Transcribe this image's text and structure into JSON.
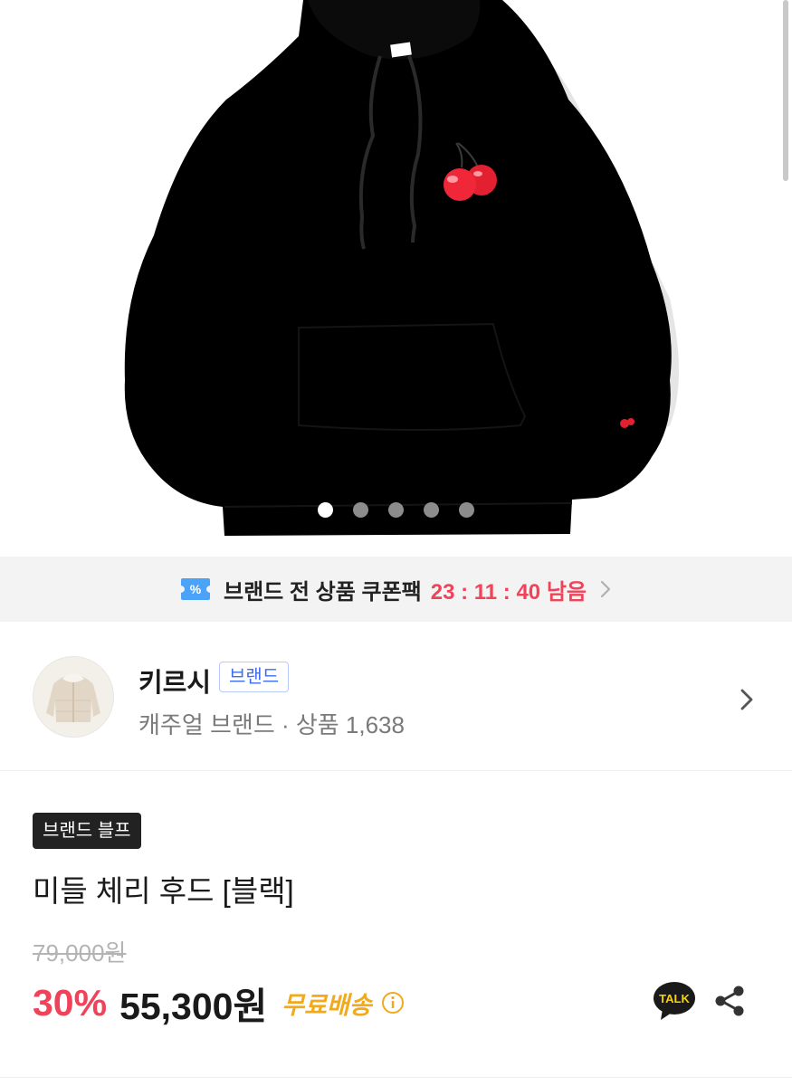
{
  "carousel": {
    "slide_count": 5,
    "active_index": 0
  },
  "coupon_banner": {
    "text": "브랜드 전 상품 쿠폰팩",
    "timer": "23 : 11 : 40 남음",
    "icon": "coupon-ticket-icon",
    "accent_color": "#f0435a"
  },
  "brand": {
    "name": "키르시",
    "tag": "브랜드",
    "meta": "캐주얼 브랜드 · 상품 1,638",
    "avatar_icon": "jacket-thumbnail"
  },
  "product": {
    "badge": "브랜드 블프",
    "title": "미들 체리 후드 [블랙]",
    "original_price": "79,000원",
    "discount": "30%",
    "sale_price": "55,300원",
    "shipping": "무료배송",
    "talk_label": "TALK"
  }
}
